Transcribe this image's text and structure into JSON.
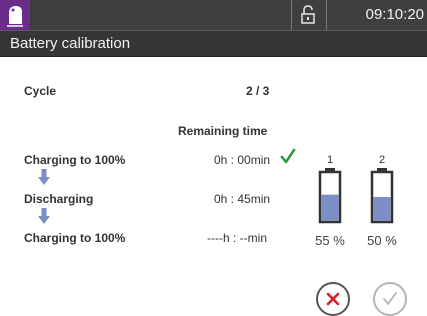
{
  "status_bar": {
    "logo_icon": "brand-logo-icon",
    "lock_icon": "unlocked-padlock-icon",
    "time": "09:10:20"
  },
  "header": {
    "title": "Battery calibration"
  },
  "cycle": {
    "label": "Cycle",
    "value": "2 / 3"
  },
  "remaining_time_header": "Remaining time",
  "steps": [
    {
      "label": "Charging to 100%",
      "time": "0h : 00min",
      "done": true
    },
    {
      "label": "Discharging",
      "time": "0h : 45min",
      "done": false
    },
    {
      "label": "Charging to 100%",
      "time": "----h : --min",
      "done": false
    }
  ],
  "batteries": [
    {
      "number": "1",
      "percent": "55 %",
      "level": 0.55
    },
    {
      "number": "2",
      "percent": "50 %",
      "level": 0.5
    }
  ],
  "colors": {
    "topbar": "#3f3f3f",
    "logo_bg": "#6a2d8c",
    "battery_fill": "#7b8fc6",
    "arrow": "#7b8fc6",
    "check": "#2e9b3c",
    "cancel_x": "#d8202a"
  },
  "actions": {
    "cancel_icon": "cancel-x-icon",
    "confirm_icon": "confirm-check-icon"
  }
}
